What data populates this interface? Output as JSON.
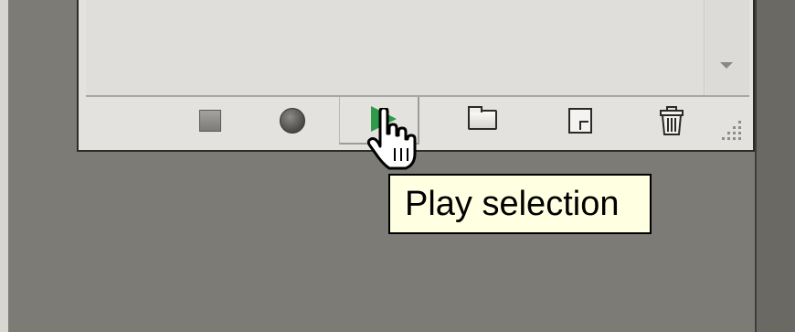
{
  "panel": {
    "buttons": [
      {
        "name": "stop-playing-recording",
        "icon": "stop-icon"
      },
      {
        "name": "begin-recording",
        "icon": "record-icon"
      },
      {
        "name": "play-selection",
        "icon": "play-icon",
        "active": true
      },
      {
        "name": "create-new-set",
        "icon": "folder-icon"
      },
      {
        "name": "create-new-action",
        "icon": "new-action-icon"
      },
      {
        "name": "delete",
        "icon": "trash-icon"
      }
    ],
    "scroll_icon": "scroll-down-arrow-icon",
    "grip_icon": "resize-grip-icon"
  },
  "tooltip": {
    "text": "Play selection"
  },
  "colors": {
    "background": "#7d7b76",
    "panel": "#e4e2de",
    "tooltip_bg": "#ffffe1",
    "play_green": "#2e9a4a"
  }
}
